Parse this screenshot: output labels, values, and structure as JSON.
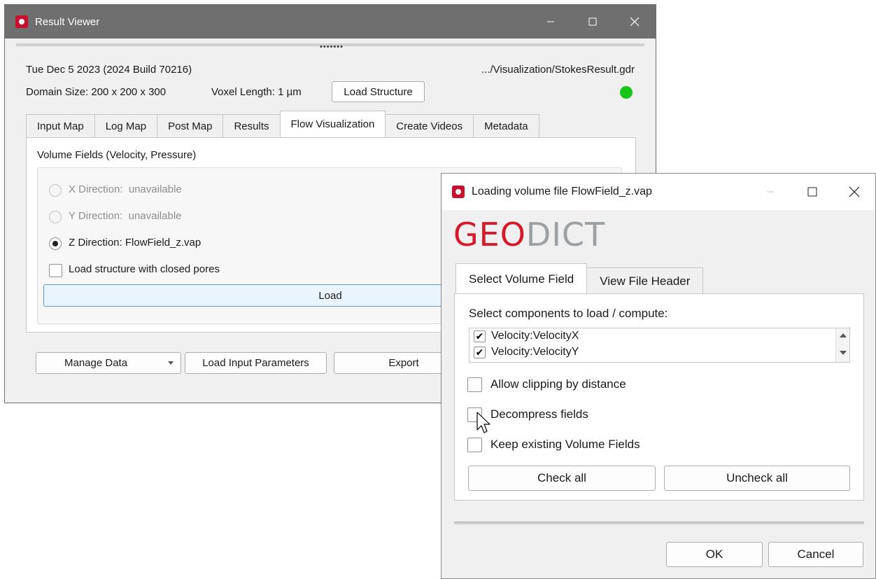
{
  "result_viewer": {
    "title": "Result Viewer",
    "date_build": "Tue Dec 5 2023 (2024 Build 70216)",
    "file_path": ".../Visualization/StokesResult.gdr",
    "domain_size": "Domain Size: 200 x 200 x 300",
    "voxel_length": "Voxel Length: 1 µm",
    "load_structure_label": "Load Structure",
    "status_color": "#17c617",
    "tabs": [
      {
        "label": "Input Map"
      },
      {
        "label": "Log Map"
      },
      {
        "label": "Post Map"
      },
      {
        "label": "Results"
      },
      {
        "label": "Flow Visualization",
        "active": true
      },
      {
        "label": "Create Videos"
      },
      {
        "label": "Metadata"
      }
    ],
    "section_title": "Volume Fields (Velocity, Pressure)",
    "options": [
      {
        "label": "X Direction:",
        "value": "unavailable",
        "enabled": false,
        "checked": false
      },
      {
        "label": "Y Direction:",
        "value": "unavailable",
        "enabled": false,
        "checked": false
      },
      {
        "label": "Z Direction: FlowField_z.vap",
        "value": "",
        "enabled": true,
        "checked": true
      }
    ],
    "closed_pores_label": "Load structure with closed pores",
    "load_label": "Load",
    "bottom_buttons": {
      "manage_data": "Manage Data",
      "load_input_parameters": "Load Input Parameters",
      "export": "Export"
    }
  },
  "dialog": {
    "title": "Loading volume file FlowField_z.vap",
    "logo_geo": "GEO",
    "logo_dict": "DICT",
    "tabs": [
      {
        "label": "Select Volume Field",
        "active": true
      },
      {
        "label": "View File Header"
      }
    ],
    "components_label": "Select components to load / compute:",
    "components": [
      {
        "label": "Velocity:VelocityX",
        "checked": true
      },
      {
        "label": "Velocity:VelocityY",
        "checked": true
      }
    ],
    "allow_clipping": "Allow clipping by distance",
    "decompress": "Decompress fields",
    "keep_existing": "Keep existing Volume Fields",
    "check_all": "Check all",
    "uncheck_all": "Uncheck all",
    "ok": "OK",
    "cancel": "Cancel"
  },
  "icons": {
    "app": "geodict-app-icon",
    "minimize": "minimize-icon",
    "maximize": "maximize-icon",
    "close": "close-icon",
    "dropdown": "chevron-down-icon",
    "cursor": "mouse-cursor-icon"
  },
  "colors": {
    "title_bar_inactive": "#6f6f6f",
    "geo_red": "#d7182a",
    "dict_gray": "#9aa0a4",
    "load_button_accent": "#5b9bd5"
  }
}
